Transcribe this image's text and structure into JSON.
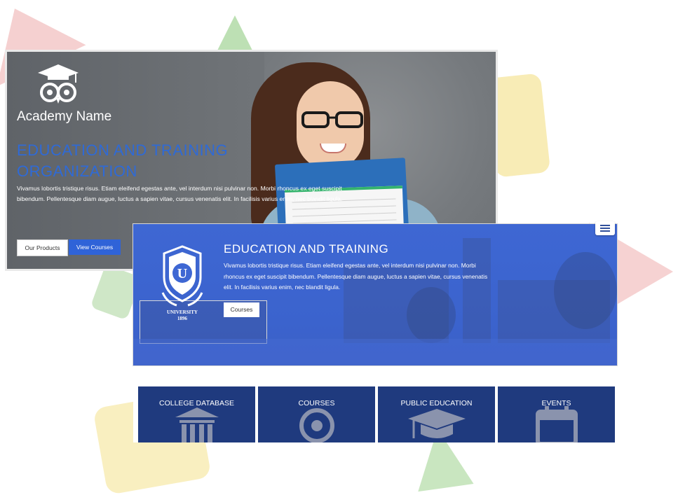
{
  "hero1": {
    "academy_name": "Academy Name",
    "heading": "EDUCATION AND TRAINING ORGANIZATION",
    "body": "Vivamus lobortis tristique risus. Etiam eleifend egestas ante, vel interdum nisi pulvinar non. Morbi rhoncus ex eget suscipit bibendum. Pellentesque diam augue, luctus a sapien vitae, cursus venenatis elit. In facilisis varius enim, nec blandit ligula.",
    "primary_button": "Our Products",
    "secondary_button": "View Courses",
    "logo_icon": "owl-graduation-cap-icon"
  },
  "hero2": {
    "heading": "EDUCATION AND TRAINING",
    "body": "Vivamus lobortis tristique risus. Etiam eleifend egestas ante, vel interdum nisi pulvinar non. Morbi rhoncus ex eget suscipit bibendum. Pellentesque diam augue, luctus a sapien vitae, cursus venenatis elit. In facilisis varius enim, nec blandit ligula.",
    "button": "Courses",
    "crest_text": "UNIVERSITY",
    "crest_year": "1896",
    "crest_letter": "U",
    "menu_icon": "hamburger-menu-icon"
  },
  "tiles": [
    {
      "label": "COLLEGE DATABASE",
      "icon": "building-columns-icon"
    },
    {
      "label": "COURSES",
      "icon": "target-icon"
    },
    {
      "label": "PUBLIC EDUCATION",
      "icon": "graduation-cap-icon"
    },
    {
      "label": "EVENTS",
      "icon": "calendar-icon"
    }
  ],
  "colors": {
    "accent_blue": "#2f63d8",
    "hero_blue": "#3e67d3",
    "tile_navy": "#1f3a7e"
  }
}
